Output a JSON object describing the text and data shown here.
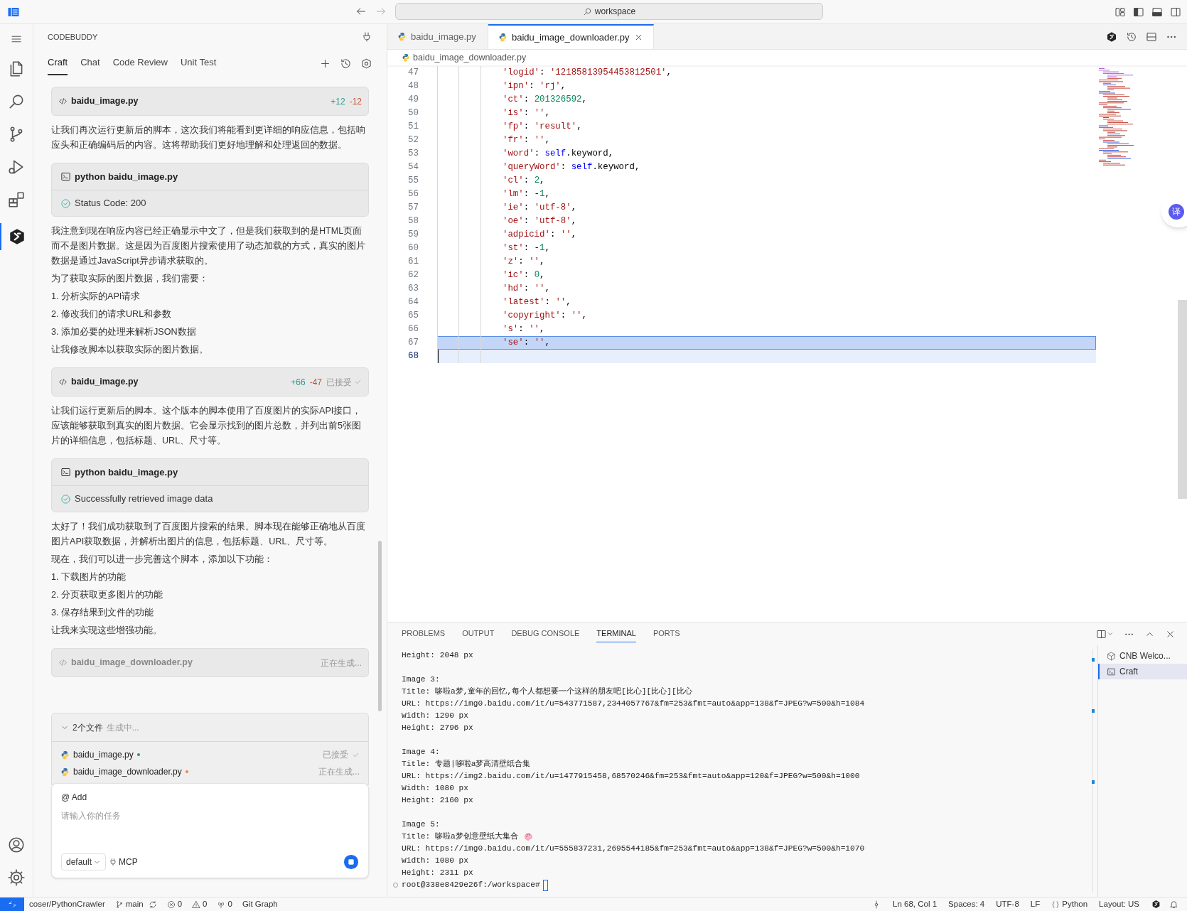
{
  "title_bar": {
    "search": "workspace"
  },
  "side_panel": {
    "title": "CODEBUDDY",
    "tabs": [
      {
        "label": "Craft",
        "selected": true
      },
      {
        "label": "Chat",
        "selected": false
      },
      {
        "label": "Code Review",
        "selected": false
      },
      {
        "label": "Unit Test",
        "selected": false
      }
    ],
    "messages": [
      {
        "kind": "file_card",
        "file": "baidu_image.py",
        "added": "+12",
        "removed": "-12",
        "accepted": false,
        "generating": false
      },
      {
        "kind": "paragraph",
        "text": "让我们再次运行更新后的脚本，这次我们将能看到更详细的响应信息，包括响应头和正确编码后的内容。这将帮助我们更好地理解和处理返回的数据。"
      },
      {
        "kind": "command_card",
        "command": "python baidu_image.py",
        "result": "Status Code: 200"
      },
      {
        "kind": "paragraph",
        "text": "我注意到现在响应内容已经正确显示中文了，但是我们获取到的是HTML页面而不是图片数据。这是因为百度图片搜索使用了动态加载的方式，真实的图片数据是通过JavaScript异步请求获取的。"
      },
      {
        "kind": "paragraph",
        "text": "为了获取实际的图片数据，我们需要："
      },
      {
        "kind": "paragraph",
        "text": "1. 分析实际的API请求"
      },
      {
        "kind": "paragraph",
        "text": "2. 修改我们的请求URL和参数"
      },
      {
        "kind": "paragraph",
        "text": "3. 添加必要的处理来解析JSON数据"
      },
      {
        "kind": "paragraph",
        "text": "让我修改脚本以获取实际的图片数据。"
      },
      {
        "kind": "file_card",
        "file": "baidu_image.py",
        "added": "+66",
        "removed": "-47",
        "status": "已接受",
        "accepted": true,
        "generating": false
      },
      {
        "kind": "paragraph",
        "text": "让我们运行更新后的脚本。这个版本的脚本使用了百度图片的实际API接口，应该能够获取到真实的图片数据。它会显示找到的图片总数，并列出前5张图片的详细信息，包括标题、URL、尺寸等。"
      },
      {
        "kind": "command_card",
        "command": "python baidu_image.py",
        "result": "Successfully retrieved image data"
      },
      {
        "kind": "paragraph",
        "text": "太好了！我们成功获取到了百度图片搜索的结果。脚本现在能够正确地从百度图片API获取数据，并解析出图片的信息，包括标题、URL、尺寸等。"
      },
      {
        "kind": "paragraph",
        "text": "现在，我们可以进一步完善这个脚本，添加以下功能："
      },
      {
        "kind": "paragraph",
        "text": "1. 下载图片的功能"
      },
      {
        "kind": "paragraph",
        "text": "2. 分页获取更多图片的功能"
      },
      {
        "kind": "paragraph",
        "text": "3. 保存结果到文件的功能"
      },
      {
        "kind": "paragraph",
        "text": "让我来实现这些增强功能。"
      },
      {
        "kind": "file_card",
        "file": "baidu_image_downloader.py",
        "status": "正在生成...",
        "accepted": false,
        "generating": true
      }
    ],
    "files_block": {
      "count_label": "2个文件",
      "status": "生成中...",
      "expanded": true,
      "files": [
        {
          "name": "baidu_image.py",
          "color": "#1f9d63",
          "status": "已接受",
          "accepted": true
        },
        {
          "name": "baidu_image_downloader.py",
          "color": "#e8834e",
          "status": "正在生成...",
          "accepted": false
        }
      ]
    },
    "input": {
      "mention": "@ Add",
      "placeholder": "请输入你的任务",
      "model": "default",
      "tool": "MCP"
    }
  },
  "editor": {
    "tabs": [
      {
        "label": "baidu_image.py",
        "selected": false
      },
      {
        "label": "baidu_image_downloader.py",
        "selected": true
      }
    ],
    "breadcrumb": "baidu_image_downloader.py",
    "lines": [
      {
        "n": "47",
        "selected": false,
        "cursor": false,
        "tokens": [
          {
            "kind": "string",
            "text": "'logid'"
          },
          {
            "kind": "plain",
            "text": ": "
          },
          {
            "kind": "string",
            "text": "'12185813954453812501'"
          },
          {
            "kind": "plain",
            "text": ","
          }
        ]
      },
      {
        "n": "48",
        "selected": false,
        "cursor": false,
        "tokens": [
          {
            "kind": "string",
            "text": "'ipn'"
          },
          {
            "kind": "plain",
            "text": ": "
          },
          {
            "kind": "string",
            "text": "'rj'"
          },
          {
            "kind": "plain",
            "text": ","
          }
        ]
      },
      {
        "n": "49",
        "selected": false,
        "cursor": false,
        "tokens": [
          {
            "kind": "string",
            "text": "'ct'"
          },
          {
            "kind": "plain",
            "text": ": "
          },
          {
            "kind": "number",
            "text": "201326592"
          },
          {
            "kind": "plain",
            "text": ","
          }
        ]
      },
      {
        "n": "50",
        "selected": false,
        "cursor": false,
        "tokens": [
          {
            "kind": "string",
            "text": "'is'"
          },
          {
            "kind": "plain",
            "text": ": "
          },
          {
            "kind": "string",
            "text": "''"
          },
          {
            "kind": "plain",
            "text": ","
          }
        ]
      },
      {
        "n": "51",
        "selected": false,
        "cursor": false,
        "tokens": [
          {
            "kind": "string",
            "text": "'fp'"
          },
          {
            "kind": "plain",
            "text": ": "
          },
          {
            "kind": "string",
            "text": "'result'"
          },
          {
            "kind": "plain",
            "text": ","
          }
        ]
      },
      {
        "n": "52",
        "selected": false,
        "cursor": false,
        "tokens": [
          {
            "kind": "string",
            "text": "'fr'"
          },
          {
            "kind": "plain",
            "text": ": "
          },
          {
            "kind": "string",
            "text": "''"
          },
          {
            "kind": "plain",
            "text": ","
          }
        ]
      },
      {
        "n": "53",
        "selected": false,
        "cursor": false,
        "tokens": [
          {
            "kind": "string",
            "text": "'word'"
          },
          {
            "kind": "plain",
            "text": ": "
          },
          {
            "kind": "keyword",
            "text": "self"
          },
          {
            "kind": "plain",
            "text": ".keyword,"
          }
        ]
      },
      {
        "n": "54",
        "selected": false,
        "cursor": false,
        "tokens": [
          {
            "kind": "string",
            "text": "'queryWord'"
          },
          {
            "kind": "plain",
            "text": ": "
          },
          {
            "kind": "keyword",
            "text": "self"
          },
          {
            "kind": "plain",
            "text": ".keyword,"
          }
        ]
      },
      {
        "n": "55",
        "selected": false,
        "cursor": false,
        "tokens": [
          {
            "kind": "string",
            "text": "'cl'"
          },
          {
            "kind": "plain",
            "text": ": "
          },
          {
            "kind": "number",
            "text": "2"
          },
          {
            "kind": "plain",
            "text": ","
          }
        ]
      },
      {
        "n": "56",
        "selected": false,
        "cursor": false,
        "tokens": [
          {
            "kind": "string",
            "text": "'lm'"
          },
          {
            "kind": "plain",
            "text": ": -"
          },
          {
            "kind": "number",
            "text": "1"
          },
          {
            "kind": "plain",
            "text": ","
          }
        ]
      },
      {
        "n": "57",
        "selected": false,
        "cursor": false,
        "tokens": [
          {
            "kind": "string",
            "text": "'ie'"
          },
          {
            "kind": "plain",
            "text": ": "
          },
          {
            "kind": "string",
            "text": "'utf-8'"
          },
          {
            "kind": "plain",
            "text": ","
          }
        ]
      },
      {
        "n": "58",
        "selected": false,
        "cursor": false,
        "tokens": [
          {
            "kind": "string",
            "text": "'oe'"
          },
          {
            "kind": "plain",
            "text": ": "
          },
          {
            "kind": "string",
            "text": "'utf-8'"
          },
          {
            "kind": "plain",
            "text": ","
          }
        ]
      },
      {
        "n": "59",
        "selected": false,
        "cursor": false,
        "tokens": [
          {
            "kind": "string",
            "text": "'adpicid'"
          },
          {
            "kind": "plain",
            "text": ": "
          },
          {
            "kind": "string",
            "text": "''"
          },
          {
            "kind": "plain",
            "text": ","
          }
        ]
      },
      {
        "n": "60",
        "selected": false,
        "cursor": false,
        "tokens": [
          {
            "kind": "string",
            "text": "'st'"
          },
          {
            "kind": "plain",
            "text": ": -"
          },
          {
            "kind": "number",
            "text": "1"
          },
          {
            "kind": "plain",
            "text": ","
          }
        ]
      },
      {
        "n": "61",
        "selected": false,
        "cursor": false,
        "tokens": [
          {
            "kind": "string",
            "text": "'z'"
          },
          {
            "kind": "plain",
            "text": ": "
          },
          {
            "kind": "string",
            "text": "''"
          },
          {
            "kind": "plain",
            "text": ","
          }
        ]
      },
      {
        "n": "62",
        "selected": false,
        "cursor": false,
        "tokens": [
          {
            "kind": "string",
            "text": "'ic'"
          },
          {
            "kind": "plain",
            "text": ": "
          },
          {
            "kind": "number",
            "text": "0"
          },
          {
            "kind": "plain",
            "text": ","
          }
        ]
      },
      {
        "n": "63",
        "selected": false,
        "cursor": false,
        "tokens": [
          {
            "kind": "string",
            "text": "'hd'"
          },
          {
            "kind": "plain",
            "text": ": "
          },
          {
            "kind": "string",
            "text": "''"
          },
          {
            "kind": "plain",
            "text": ","
          }
        ]
      },
      {
        "n": "64",
        "selected": false,
        "cursor": false,
        "tokens": [
          {
            "kind": "string",
            "text": "'latest'"
          },
          {
            "kind": "plain",
            "text": ": "
          },
          {
            "kind": "string",
            "text": "''"
          },
          {
            "kind": "plain",
            "text": ","
          }
        ]
      },
      {
        "n": "65",
        "selected": false,
        "cursor": false,
        "tokens": [
          {
            "kind": "string",
            "text": "'copyright'"
          },
          {
            "kind": "plain",
            "text": ": "
          },
          {
            "kind": "string",
            "text": "''"
          },
          {
            "kind": "plain",
            "text": ","
          }
        ]
      },
      {
        "n": "66",
        "selected": false,
        "cursor": false,
        "tokens": [
          {
            "kind": "string",
            "text": "'s'"
          },
          {
            "kind": "plain",
            "text": ": "
          },
          {
            "kind": "string",
            "text": "''"
          },
          {
            "kind": "plain",
            "text": ","
          }
        ]
      },
      {
        "n": "67",
        "selected": true,
        "cursor": false,
        "tokens": [
          {
            "kind": "string",
            "text": "'se'"
          },
          {
            "kind": "plain",
            "text": ": "
          },
          {
            "kind": "string",
            "text": "''"
          },
          {
            "kind": "plain",
            "text": ","
          }
        ]
      },
      {
        "n": "68",
        "selected": false,
        "cursor": true
      }
    ],
    "translate_button": "译"
  },
  "panel": {
    "tabs": [
      {
        "label": "PROBLEMS",
        "selected": false
      },
      {
        "label": "OUTPUT",
        "selected": false
      },
      {
        "label": "DEBUG CONSOLE",
        "selected": false
      },
      {
        "label": "TERMINAL",
        "selected": true
      },
      {
        "label": "PORTS",
        "selected": false
      }
    ],
    "terminal_blocks": [
      {
        "lines": [
          {
            "kind": "plain",
            "text": "Height: 2048 px"
          }
        ]
      },
      {
        "lines": [
          {
            "kind": "plain",
            "text": "Image 3:"
          },
          {
            "kind": "plain",
            "text": "Title: 哆啦a梦,童年的回忆,每个人都想要一个这样的朋友吧[比心][比心][比心"
          },
          {
            "kind": "plain",
            "text": "URL: https://img0.baidu.com/it/u=543771587,2344057767&fm=253&fmt=auto&app=138&f=JPEG?w=500&h=1084"
          },
          {
            "kind": "plain",
            "text": "Width: 1290 px"
          },
          {
            "kind": "plain",
            "text": "Height: 2796 px"
          }
        ]
      },
      {
        "lines": [
          {
            "kind": "plain",
            "text": "Image 4:"
          },
          {
            "kind": "plain",
            "text": "Title: 专题|哆啦a梦高清壁纸合集"
          },
          {
            "kind": "plain",
            "text": "URL: https://img2.baidu.com/it/u=1477915458,68570246&fm=253&fmt=auto&app=120&f=JPEG?w=500&h=1000"
          },
          {
            "kind": "plain",
            "text": "Width: 1080 px"
          },
          {
            "kind": "plain",
            "text": "Height: 2160 px"
          }
        ]
      },
      {
        "lines": [
          {
            "kind": "plain",
            "text": "Image 5:"
          },
          {
            "kind": "palette",
            "text": "Title: 哆啦a梦创意壁纸大集合"
          },
          {
            "kind": "plain",
            "text": "URL: https://img0.baidu.com/it/u=555837231,2695544185&fm=253&fmt=auto&app=138&f=JPEG?w=500&h=1070"
          },
          {
            "kind": "plain",
            "text": "Width: 1080 px"
          },
          {
            "kind": "plain",
            "text": "Height: 2311 px"
          }
        ]
      }
    ],
    "prompt": "root@338e8429e26f:/workspace#",
    "terminals": [
      {
        "label": "CNB Welco...",
        "kind": "cnb",
        "selected": false
      },
      {
        "label": "Craft",
        "kind": "shell",
        "selected": true
      }
    ]
  },
  "status_bar": {
    "left": [
      {
        "kind": "plain",
        "text": "coser/PythonCrawler"
      },
      {
        "kind": "branch",
        "text": "main"
      },
      {
        "kind": "errors",
        "text": "0"
      },
      {
        "kind": "warnings",
        "text": "0"
      },
      {
        "kind": "ports",
        "text": "0"
      },
      {
        "kind": "plain",
        "text": "Git Graph"
      }
    ],
    "right": [
      {
        "kind": "plain",
        "text": "Ln 68, Col 1"
      },
      {
        "kind": "plain",
        "text": "Spaces: 4"
      },
      {
        "kind": "plain",
        "text": "UTF-8"
      },
      {
        "kind": "plain",
        "text": "LF"
      },
      {
        "kind": "language",
        "text": "Python"
      },
      {
        "kind": "plain",
        "text": "Layout: US"
      }
    ]
  }
}
